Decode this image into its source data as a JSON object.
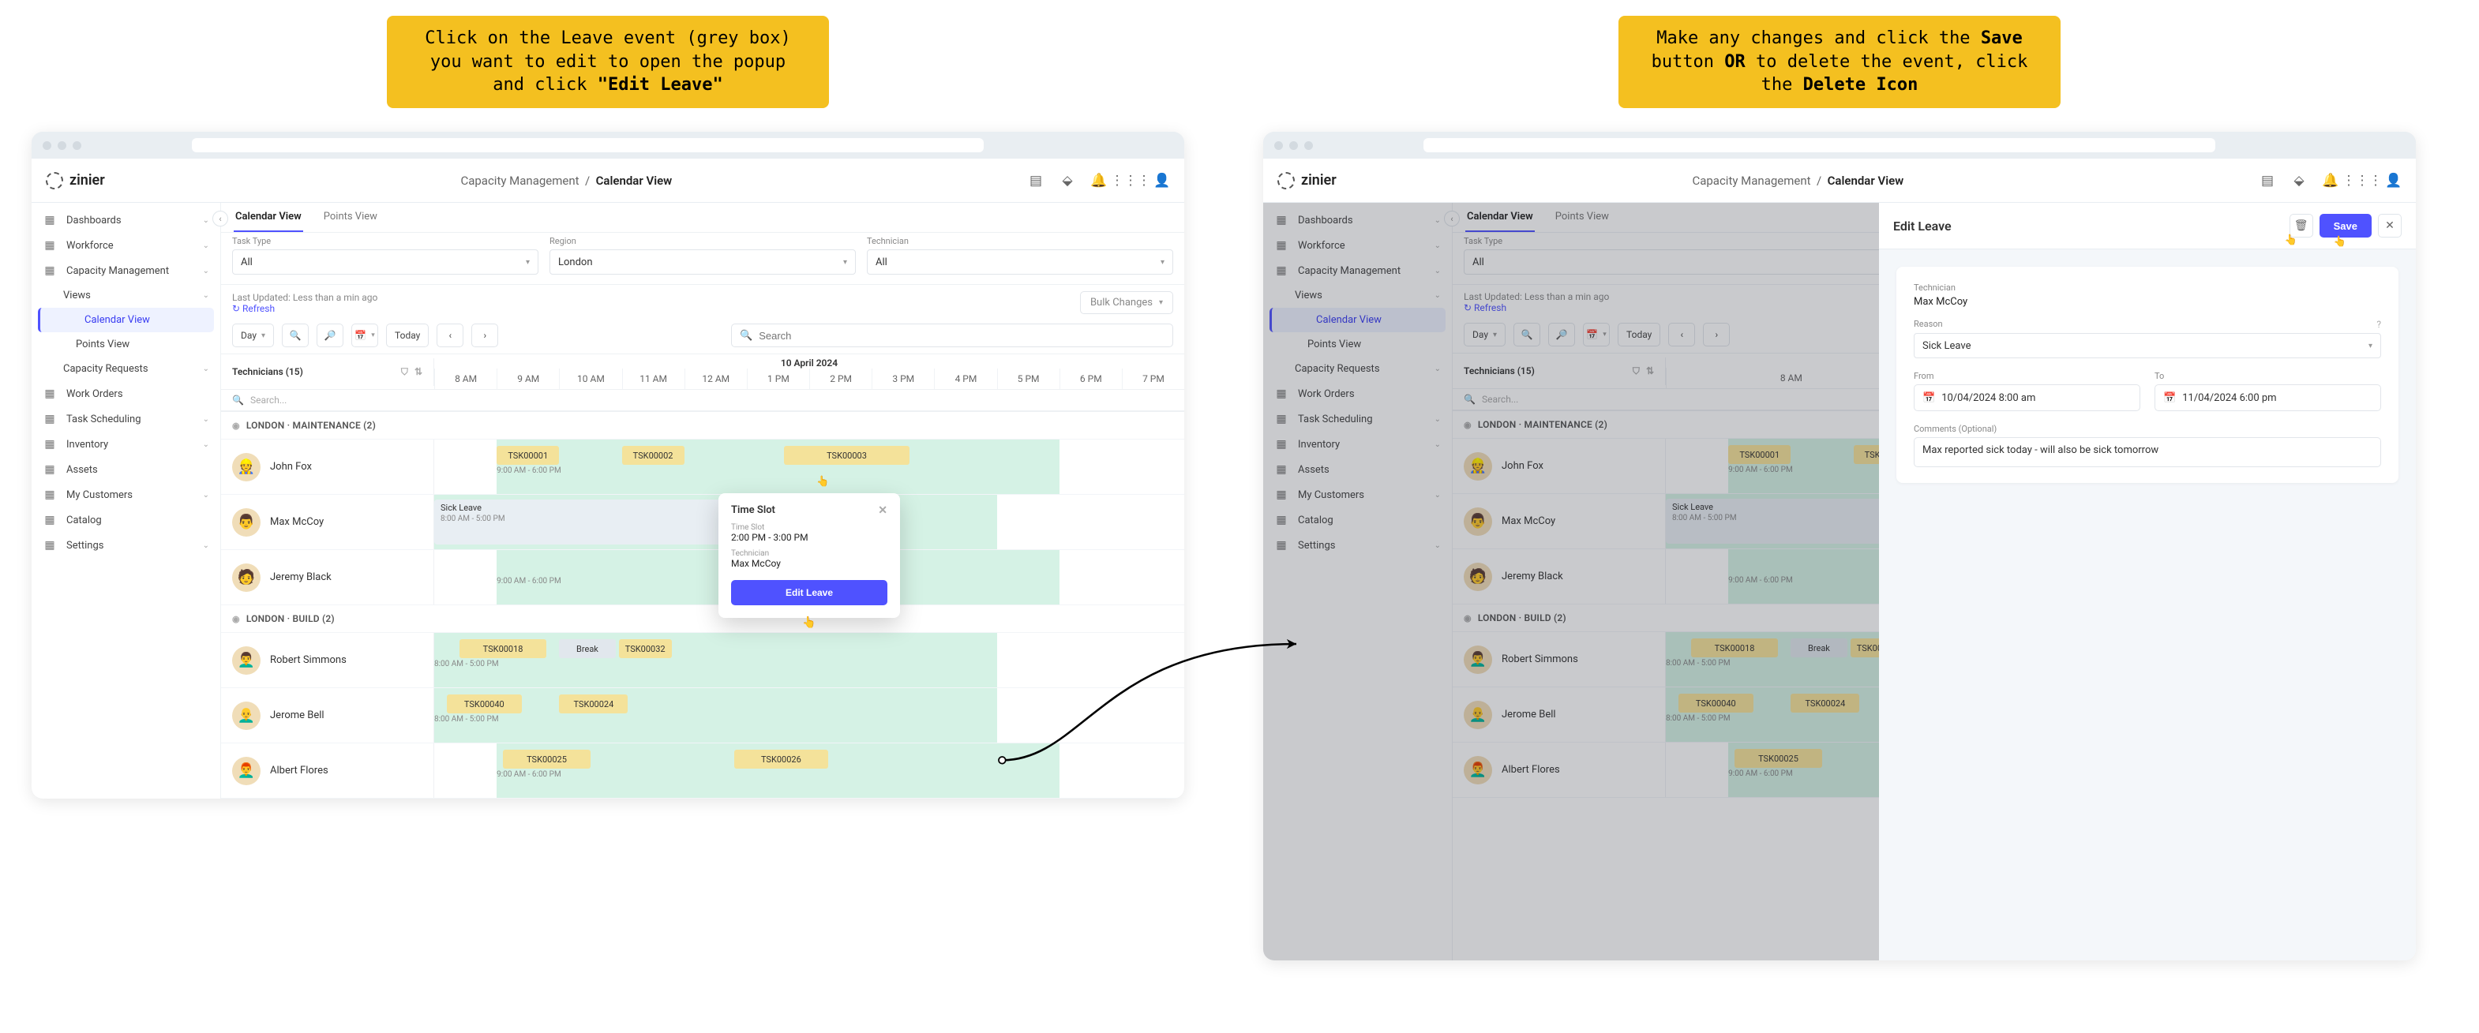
{
  "callouts": {
    "left_a": "Click on the Leave event (grey box) you want to edit to open the popup and click ",
    "left_b": "\"Edit Leave\"",
    "right_a": "Make any changes and click the ",
    "right_b": "Save",
    "right_c": " button ",
    "right_d": "OR",
    "right_e": " to delete the event, click the ",
    "right_f": "Delete Icon"
  },
  "brand": "zinier",
  "crumbs": {
    "parent": "Capacity Management",
    "current": "Calendar View"
  },
  "sidebar": {
    "items": [
      {
        "label": "Dashboards",
        "chev": true
      },
      {
        "label": "Workforce",
        "chev": true
      },
      {
        "label": "Capacity Management",
        "chev": true
      },
      {
        "label": "Views",
        "chev": true,
        "sub": true
      },
      {
        "label": "Calendar View",
        "sub2": true,
        "active": true
      },
      {
        "label": "Points View",
        "sub2": true
      },
      {
        "label": "Capacity Requests",
        "sub": true,
        "chev": true
      },
      {
        "label": "Work Orders"
      },
      {
        "label": "Task Scheduling",
        "chev": true
      },
      {
        "label": "Inventory",
        "chev": true
      },
      {
        "label": "Assets"
      },
      {
        "label": "My Customers",
        "chev": true
      },
      {
        "label": "Catalog"
      },
      {
        "label": "Settings",
        "chev": true
      }
    ]
  },
  "tabs": {
    "calendar": "Calendar View",
    "points": "Points View"
  },
  "filters": {
    "task_type_label": "Task Type",
    "task_type_value": "All",
    "region_label": "Region",
    "region_value": "London",
    "technician_label": "Technician",
    "technician_value": "All"
  },
  "meta": {
    "last_updated": "Last Updated: Less than a min ago",
    "refresh": "↻ Refresh",
    "bulk": "Bulk Changes"
  },
  "toolbar": {
    "day": "Day",
    "today": "Today",
    "search_ph": "Search"
  },
  "grid": {
    "tech_header": "Technicians (15)",
    "tech_search_ph": "Search...",
    "date": "10 April 2024",
    "hours": [
      "8 AM",
      "9 AM",
      "10 AM",
      "11 AM",
      "12 AM",
      "1 PM",
      "2 PM",
      "3 PM",
      "4 PM",
      "5 PM",
      "6 PM",
      "7 PM"
    ],
    "groups": [
      {
        "label": "LONDON · MAINTENANCE (2)",
        "techs": [
          {
            "name": "John Fox",
            "avatar": "👷",
            "shift": "9:00 AM - 6:00 PM",
            "shift_span": [
              1,
              10
            ],
            "tasks": [
              {
                "label": "TSK00001",
                "span": [
                  1,
                  2
                ]
              },
              {
                "label": "TSK00002",
                "span": [
                  3,
                  4
                ]
              },
              {
                "label": "TSK00003",
                "span": [
                  5.6,
                  7.6
                ]
              }
            ]
          },
          {
            "name": "Max McCoy",
            "avatar": "👨",
            "shift": "8:00 AM - 5:00 PM",
            "shift_span": [
              0,
              9
            ],
            "leave": {
              "label": "Sick Leave",
              "time": "8:00 AM - 5:00 PM",
              "span": [
                0,
                6
              ]
            }
          },
          {
            "name": "Jeremy Black",
            "avatar": "🧑",
            "shift": "9:00 AM - 6:00 PM",
            "shift_span": [
              1,
              10
            ]
          }
        ]
      },
      {
        "label": "LONDON · BUILD (2)",
        "techs": [
          {
            "name": "Robert Simmons",
            "avatar": "👨‍🦱",
            "shift": "8:00 AM - 5:00 PM",
            "shift_span": [
              0,
              9
            ],
            "tasks": [
              {
                "label": "TSK00018",
                "span": [
                  0.4,
                  1.8
                ]
              },
              {
                "label": "Break",
                "span": [
                  2.0,
                  2.9
                ],
                "cls": "break"
              },
              {
                "label": "TSK00032",
                "span": [
                  2.95,
                  3.8
                ]
              }
            ]
          },
          {
            "name": "Jerome Bell",
            "avatar": "👨‍🦲",
            "shift": "8:00 AM - 5:00 PM",
            "shift_span": [
              0,
              9
            ],
            "tasks": [
              {
                "label": "TSK00040",
                "span": [
                  0.2,
                  1.4
                ]
              },
              {
                "label": "TSK00024",
                "span": [
                  2.0,
                  3.1
                ]
              }
            ]
          },
          {
            "name": "Albert Flores",
            "avatar": "👨‍🦰",
            "shift": "9:00 AM - 6:00 PM",
            "shift_span": [
              1,
              10
            ],
            "tasks": [
              {
                "label": "TSK00025",
                "span": [
                  1.1,
                  2.5
                ]
              },
              {
                "label": "TSK00026",
                "span": [
                  4.8,
                  6.3
                ]
              }
            ]
          }
        ]
      }
    ]
  },
  "popup": {
    "title": "Time Slot",
    "time_label": "Time Slot",
    "time_value": "2:00 PM - 3:00 PM",
    "tech_label": "Technician",
    "tech_value": "Max McCoy",
    "button": "Edit Leave"
  },
  "drawer": {
    "title": "Edit Leave",
    "save": "Save",
    "tech_label": "Technician",
    "tech_value": "Max McCoy",
    "reason_label": "Reason",
    "reason_value": "Sick Leave",
    "from_label": "From",
    "from_value": "10/04/2024 8:00 am",
    "to_label": "To",
    "to_value": "11/04/2024 6:00 pm",
    "comments_label": "Comments (Optional)",
    "comments_value": "Max reported sick today - will also be sick tomorrow"
  }
}
